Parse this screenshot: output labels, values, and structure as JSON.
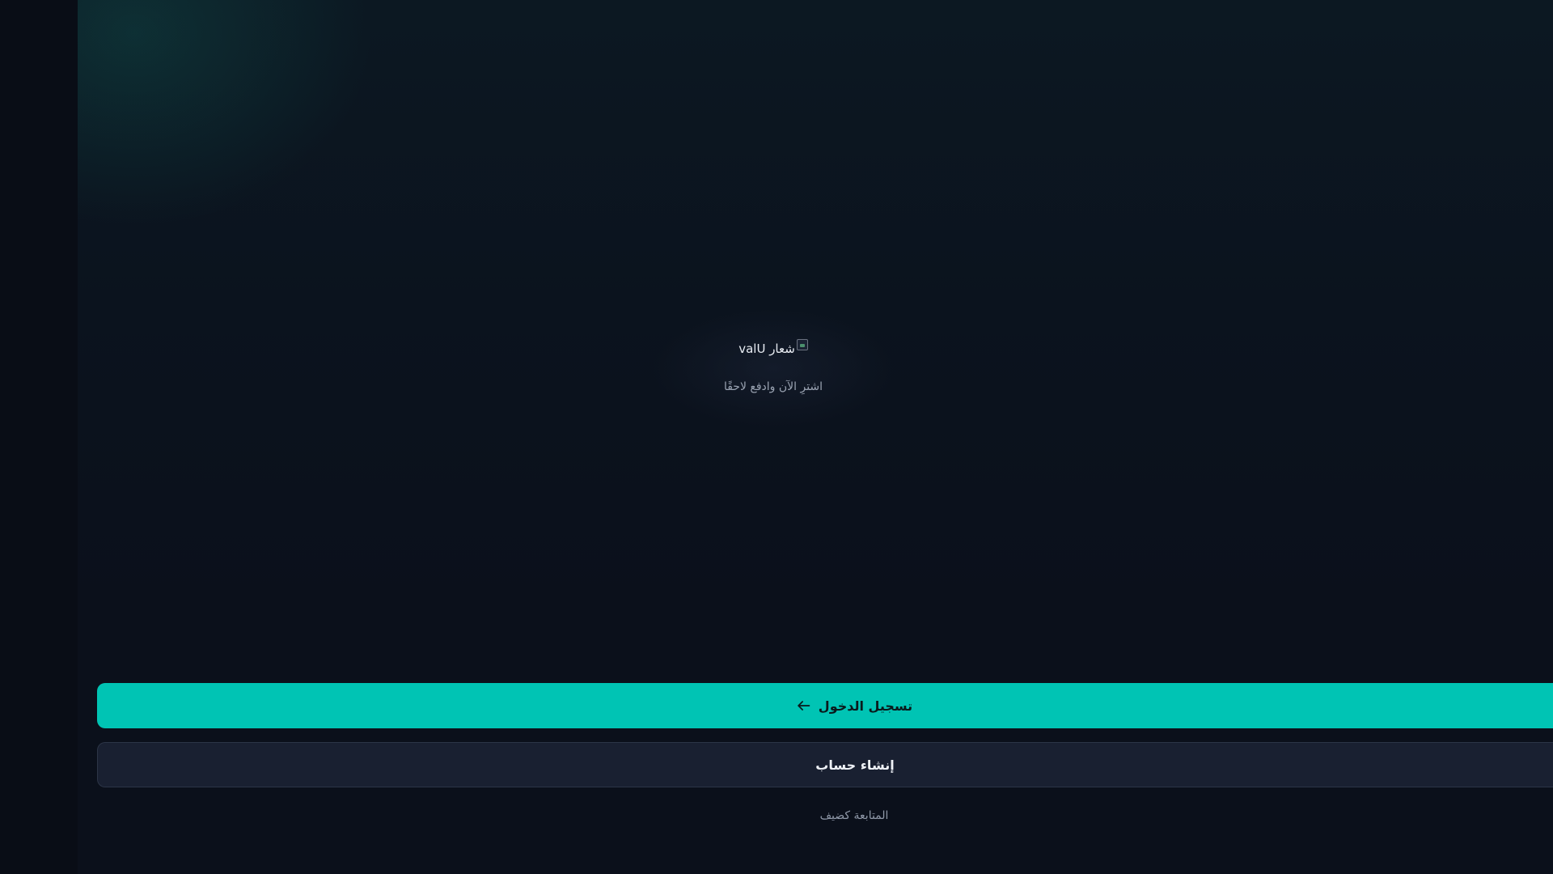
{
  "app": {
    "logo_alt": "شعار valU",
    "tagline": "اشترِ الآن وادفع لاحقًا"
  },
  "actions": {
    "login_label": "تسجيل الدخول",
    "create_account_label": "إنشاء حساب",
    "guest_label": "المتابعة كضيف"
  },
  "icons": {
    "login": "arrow-left-icon",
    "logo": "broken-image-icon"
  },
  "colors": {
    "accent": "#00c4b4",
    "background": "#0b101b",
    "secondary_button": "#192031"
  }
}
